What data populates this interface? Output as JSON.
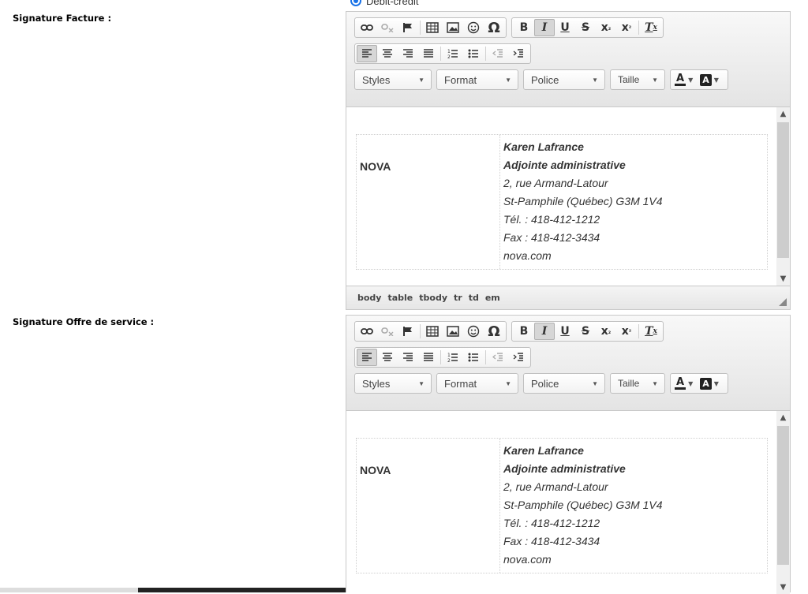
{
  "top_radio": {
    "label": "Débit-crédit"
  },
  "toolbar": {
    "styles_label": "Styles",
    "format_label": "Format",
    "font_label": "Police",
    "size_label": "Taille"
  },
  "editors": [
    {
      "label": "Signature Facture :",
      "company": "NOVA",
      "lines": [
        "Karen Lafrance",
        "Adjointe administrative",
        "2, rue Armand-Latour",
        "St-Pamphile (Québec)  G3M 1V4",
        "Tél. : 418-412-1212",
        "Fax : 418-412-3434",
        "nova.com"
      ],
      "path": [
        "body",
        "table",
        "tbody",
        "tr",
        "td",
        "em"
      ]
    },
    {
      "label": "Signature Offre de service :",
      "company": "NOVA",
      "lines": [
        "Karen Lafrance",
        "Adjointe administrative",
        "2, rue Armand-Latour",
        "St-Pamphile (Québec)  G3M 1V4",
        "Tél. : 418-412-1212",
        "Fax : 418-412-3434",
        "nova.com"
      ]
    }
  ],
  "icons": [
    "link-icon",
    "unlink-icon",
    "anchor-icon",
    "table-icon",
    "image-icon",
    "smiley-icon",
    "special-char-icon",
    "bold-icon",
    "italic-icon",
    "underline-icon",
    "strike-icon",
    "subscript-icon",
    "superscript-icon",
    "remove-format-icon",
    "align-left-icon",
    "align-center-icon",
    "align-right-icon",
    "justify-icon",
    "numbered-list-icon",
    "bulleted-list-icon",
    "outdent-icon",
    "indent-icon",
    "text-color-icon",
    "bg-color-icon"
  ],
  "colors": {
    "accent": "#1a73e8",
    "toolbar_bg": "#e8e8e8",
    "text": "#333333"
  }
}
